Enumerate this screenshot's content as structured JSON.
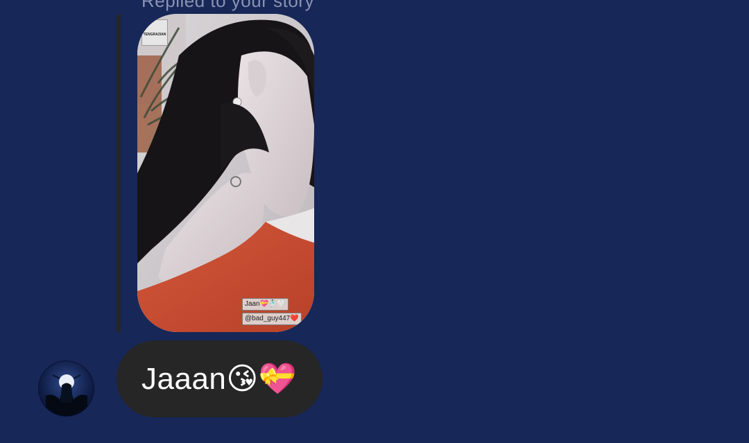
{
  "reply": {
    "caption": "Replied to your story"
  },
  "story": {
    "sticker_text": "TENGRAZIAN",
    "tag_jaan": "Jaan💝🕺🏻🤍",
    "tag_handle": "@bad_guy447❤️"
  },
  "message": {
    "text": "Jaaan😘💝"
  },
  "colors": {
    "background": "#172757",
    "bubble": "#262626",
    "reply_bar": "#262626",
    "text": "#ffffff"
  }
}
